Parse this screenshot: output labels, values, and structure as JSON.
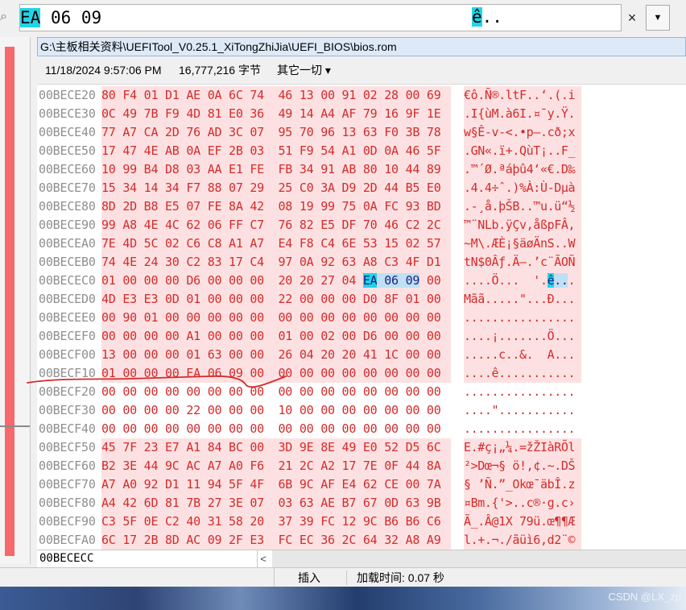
{
  "search": {
    "query_prefix": "",
    "query_hl": "EA",
    "query_rest": " 06 09",
    "ascii_hl": "ê",
    "ascii_rest": "..",
    "clear_symbol": "×",
    "dropdown_symbol": "▼"
  },
  "icons": {
    "search": "search-icon"
  },
  "path": "G:\\主板相关资料\\UEFITool_V0.25.1_XiTongZhiJia\\UEFI_BIOS\\bios.rom",
  "info": {
    "date": "11/18/2024 9:57:06 PM",
    "size": "16,777,216 字节",
    "mode": "其它一切 ▾"
  },
  "rows": [
    {
      "offset": "00BECE20",
      "hex": "80 F4 01 D1 AE 0A 6C 74  46 13 00 91 02 28 00 69",
      "ascii": "€ô.Ñ®.ltF..‘.(.i"
    },
    {
      "offset": "00BECE30",
      "hex": "0C 49 7B F9 4D 81 E0 36  49 14 A4 AF 79 16 9F 1E",
      "ascii": ".I{ùM.à6I.¤¯y.Ÿ."
    },
    {
      "offset": "00BECE40",
      "hex": "77 A7 CA 2D 76 AD 3C 07  95 70 96 13 63 F0 3B 78",
      "ascii": "w§Ê-v-<.•p–.cð;x"
    },
    {
      "offset": "00BECE50",
      "hex": "17 47 4E AB 0A EF 2B 03  51 F9 54 A1 0D 0A 46 5F",
      "ascii": ".GN«.ï+.QùT¡..F_"
    },
    {
      "offset": "00BECE60",
      "hex": "10 99 B4 D8 03 AA E1 FE  FB 34 91 AB 80 10 44 89",
      "ascii": ".™´Ø.ªáþû4‘«€.D‰"
    },
    {
      "offset": "00BECE70",
      "hex": "15 34 14 34 F7 88 07 29  25 C0 3A D9 2D 44 B5 E0",
      "ascii": ".4.4÷ˆ.)%À:Ù-Dµà"
    },
    {
      "offset": "00BECE80",
      "hex": "8D 2D B8 E5 07 FE 8A 42  08 19 99 75 0A FC 93 BD",
      "ascii": ".-¸å.þŠB..™u.ü“½"
    },
    {
      "offset": "00BECE90",
      "hex": "99 A8 4E 4C 62 06 FF C7  76 82 E5 DF 70 46 C2 2C",
      "ascii": "™¨NLb.ÿÇv‚åßpFÂ,"
    },
    {
      "offset": "00BECEA0",
      "hex": "7E 4D 5C 02 C6 C8 A1 A7  E4 F8 C4 6E 53 15 02 57",
      "ascii": "~M\\.ÆÈ¡§äøÄnS..W"
    },
    {
      "offset": "00BECEB0",
      "hex": "74 4E 24 30 C2 83 17 C4  97 0A 92 63 A8 C3 4F D1",
      "ascii": "tN$0Âƒ.Ä—.’c¨ÃOÑ"
    },
    {
      "offset": "00BECEC0",
      "hex": "01 00 00 00 D6 00 00 00  20 20 27 04 ",
      "hex_sel": "EA",
      "hex_sel2": " 06 09",
      "hex_tail": " 00",
      "ascii": "....Ö...  '.",
      "ascii_sel": "ê",
      "ascii_sel2": "..",
      "ascii_tail": "."
    },
    {
      "offset": "00BECED0",
      "hex": "4D E3 E3 0D 01 00 00 00  22 00 00 00 D0 8F 01 00",
      "ascii": "Mãã.....\"...Ð..."
    },
    {
      "offset": "00BECEE0",
      "hex": "00 90 01 00 00 00 00 00  00 00 00 00 00 00 00 00",
      "ascii": "................"
    },
    {
      "offset": "00BECEF0",
      "hex": "00 00 00 00 A1 00 00 00  01 00 02 00 D6 00 00 00",
      "ascii": "....¡.......Ö..."
    },
    {
      "offset": "00BECF00",
      "hex": "13 00 00 00 01 63 00 00  26 04 20 20 41 1C 00 00",
      "ascii": ".....c..&.  A..."
    },
    {
      "offset": "00BECF10",
      "hex": "01 00 00 00 EA 06 09 00  00 00 00 00 00 00 00 00",
      "ascii": "....ê..........."
    },
    {
      "offset": "00BECF20",
      "hex": "00 00 00 00 00 00 00 00  00 00 00 00 00 00 00 00",
      "ascii": "................",
      "zero": true
    },
    {
      "offset": "00BECF30",
      "hex": "00 00 00 00 22 00 00 00  10 00 00 00 00 00 00 00",
      "ascii": "....\"...........",
      "zero": true
    },
    {
      "offset": "00BECF40",
      "hex": "00 00 00 00 00 00 00 00  00 00 00 00 00 00 00 00",
      "ascii": "................",
      "zero": true
    },
    {
      "offset": "00BECF50",
      "hex": "45 7F 23 E7 A1 84 BC 00  3D 9E 8E 49 E0 52 D5 6C",
      "ascii": "E.#ç¡„¼.=žŽIàRÕl"
    },
    {
      "offset": "00BECF60",
      "hex": "B2 3E 44 9C AC A7 A0 F6  21 2C A2 17 7E 0F 44 8A",
      "ascii": "²>Dœ¬§ ö!,¢.~.DŠ"
    },
    {
      "offset": "00BECF70",
      "hex": "A7 A0 92 D1 11 94 5F 4F  6B 9C AF E4 62 CE 00 7A",
      "ascii": "§ ’Ñ.”_Okœ¯äbÎ.z"
    },
    {
      "offset": "00BECF80",
      "hex": "A4 42 6D 81 7B 27 3E 07  03 63 AE B7 67 0D 63 9B",
      "ascii": "¤Bm.{'>..c®·g.c›"
    },
    {
      "offset": "00BECF90",
      "hex": "C3 5F 0E C2 40 31 58 20  37 39 FC 12 9C B6 B6 C6",
      "ascii": "Ã_.Â@1X 79ü.œ¶¶Æ"
    },
    {
      "offset": "00BECFA0",
      "hex": "6C 17 2B 8D AC 09 2F E3  FC EC 36 2C 64 32 A8 A9",
      "ascii": "l.+.¬./ãüì6,d2¨©"
    }
  ],
  "footer": {
    "caret_offset": "00BECECC",
    "scroll_left": "<"
  },
  "status": {
    "insert_mode": "插入",
    "load_time": "加载时间: 0.07 秒"
  },
  "wallpaper": {
    "watermark": "CSDN @LX_zp"
  },
  "colors": {
    "hex_text": "#d42b2b",
    "hex_bg": "#fde1e2",
    "selection": "#22d4e8",
    "left_bar": "#f6686c",
    "annotation": "#d42b2b"
  }
}
